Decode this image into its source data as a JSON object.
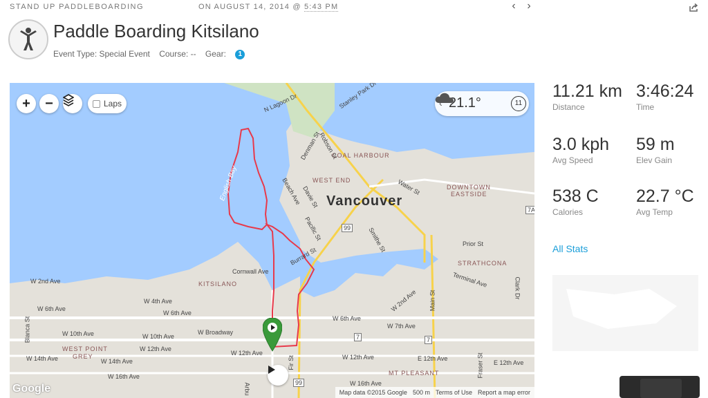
{
  "header": {
    "activity_type": "STAND UP PADDLEBOARDING",
    "date_prefix": "ON AUGUST 14, 2014 @ ",
    "time": "5:43 PM",
    "prev_icon": "chevron-left-icon",
    "next_icon": "chevron-right-icon",
    "share_icon": "share-icon"
  },
  "activity": {
    "title": "Paddle Boarding Kitsilano",
    "event_type": "Event Type: Special Event",
    "course": "Course: --",
    "gear_label": "Gear:",
    "gear_count": "1"
  },
  "map": {
    "zoom_in": "+",
    "zoom_out": "−",
    "laps_label": "Laps",
    "weather_temp": "21.1°",
    "weather_uv": "11",
    "labels": {
      "vancouver": "Vancouver",
      "english_bay": "English Bay",
      "coal_harbour": "COAL HARBOUR",
      "west_end": "WEST END",
      "downtown_eastside_1": "DOWNTOWN",
      "downtown_eastside_2": "EASTSIDE",
      "strathcona": "STRATHCONA",
      "kitsilano": "KITSILANO",
      "west_point_grey_1": "WEST POINT",
      "west_point_grey_2": "GREY",
      "mt_pleasant": "MT PLEASANT",
      "cornwall": "Cornwall Ave",
      "w4th": "W 4th Ave",
      "w6th": "W 6th Ave",
      "w6th_b": "W 6th Ave",
      "w6th_c": "W 6th Ave",
      "w10th": "W 10th Ave",
      "w10th_b": "W 10th Ave",
      "broadway": "W Broadway",
      "w12th": "W 12th Ave",
      "w12th_b": "W 12th Ave",
      "w12th_c": "W 12th Ave",
      "e12th": "E 12th Ave",
      "e12th_b": "E 12th Ave",
      "w14th": "W 14th Ave",
      "w14th_b": "W 14th Ave",
      "w16th": "W 16th Ave",
      "w2nd": "W 2nd Ave",
      "w7th": "W 7th Ave",
      "prior": "Prior St",
      "terminal": "Terminal Ave",
      "main": "Main St",
      "robson": "Robson St",
      "denman": "Denman St",
      "davie": "Davie St",
      "pacific": "Pacific St",
      "burrard": "Burrard St",
      "beach": "Beach Ave",
      "smithe": "Smithe St",
      "water": "Water St",
      "stanley": "Stanley Park Dr",
      "lagoon": "N Lagoon Dr",
      "clark": "Clark Dr",
      "fraser": "Fraser St",
      "blanca": "Blanca St",
      "w2nd_diag": "W 2nd Ave",
      "fir": "Fir St",
      "arbu": "Arbu",
      "w16th_b": "W 16th Ave",
      "hwy99": "99",
      "hwy99b": "99",
      "hwy7": "7",
      "hwy7b": "7",
      "hwy7a": "7A"
    },
    "google": "Google",
    "attribution": {
      "data": "Map data ©2015 Google",
      "scale": "500 m",
      "terms": "Terms of Use",
      "report": "Report a map error"
    },
    "route_color": "#e8394a",
    "marker_color": "#3a9a3a"
  },
  "stats": [
    {
      "value": "11.21 km",
      "label": "Distance"
    },
    {
      "value": "3:46:24",
      "label": "Time"
    },
    {
      "value": "3.0 kph",
      "label": "Avg Speed"
    },
    {
      "value": "59 m",
      "label": "Elev Gain"
    },
    {
      "value": "538 C",
      "label": "Calories"
    },
    {
      "value": "22.7 °C",
      "label": "Avg Temp"
    }
  ],
  "all_stats_link": "All Stats"
}
